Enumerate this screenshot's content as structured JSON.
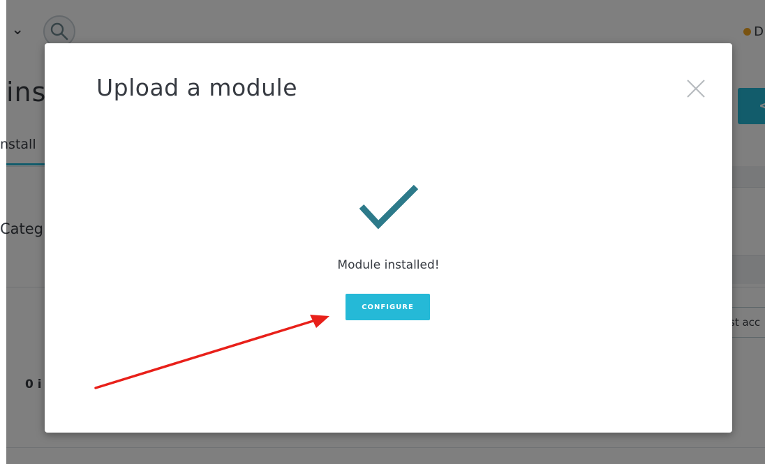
{
  "background": {
    "title_fragment": "ins",
    "tab_fragment": "nstall",
    "category_fragment": "Categ",
    "count_fragment": "0 i",
    "debug_fragment": "D",
    "filter_fragment": "st acc",
    "right_button_fragment": "<",
    "icons": {
      "chevron": "chevron-down-icon",
      "search": "search-icon",
      "debug_dot": "debug-status-icon"
    }
  },
  "modal": {
    "title": "Upload a module",
    "close_icon": "close-icon",
    "success_icon": "checkmark-icon",
    "success_message": "Module installed!",
    "configure_label": "CONFIGURE"
  },
  "colors": {
    "accent": "#25b9d7",
    "check": "#2d7a8a",
    "annotation": "#e8201a",
    "text": "#363a41"
  }
}
